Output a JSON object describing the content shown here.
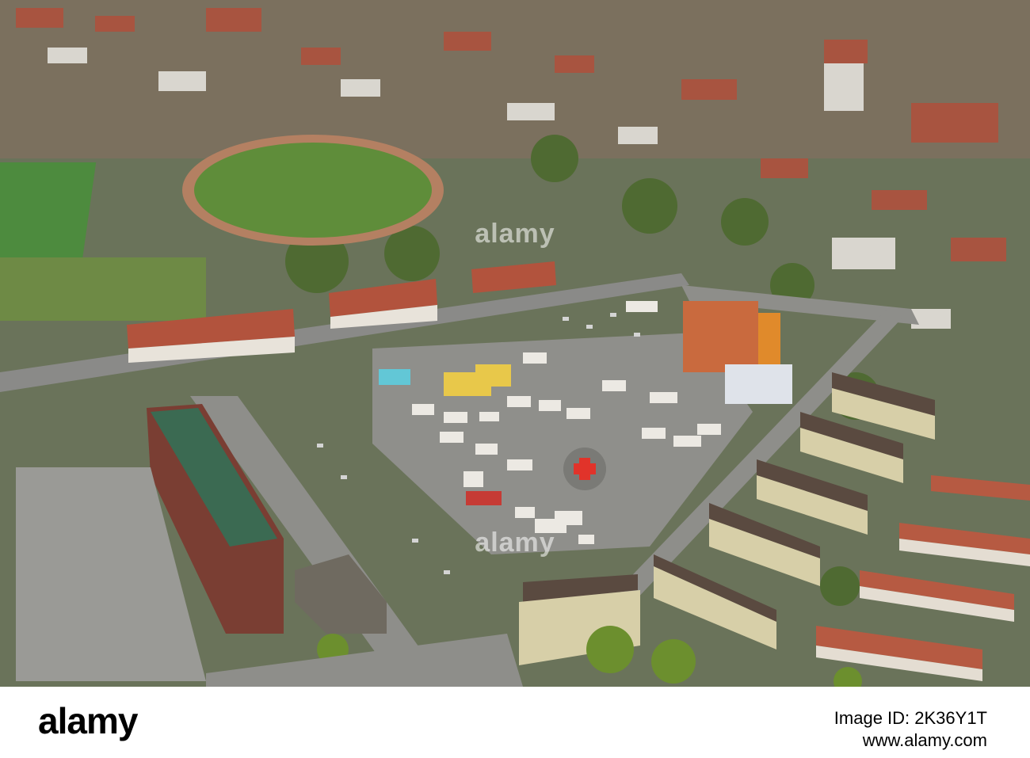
{
  "photo": {
    "subject": "aerial-town",
    "colors": {
      "grass": "#5f8d3a",
      "roof_red": "#b2533d",
      "asphalt": "#8e8e8a",
      "track": "#b57e5e",
      "helipad_cross": "#e1332a"
    }
  },
  "watermarks": [
    "alamy",
    "alamy"
  ],
  "footer": {
    "brand": "alamy",
    "image_id_label": "Image ID: 2K36Y1T",
    "url": "www.alamy.com"
  }
}
